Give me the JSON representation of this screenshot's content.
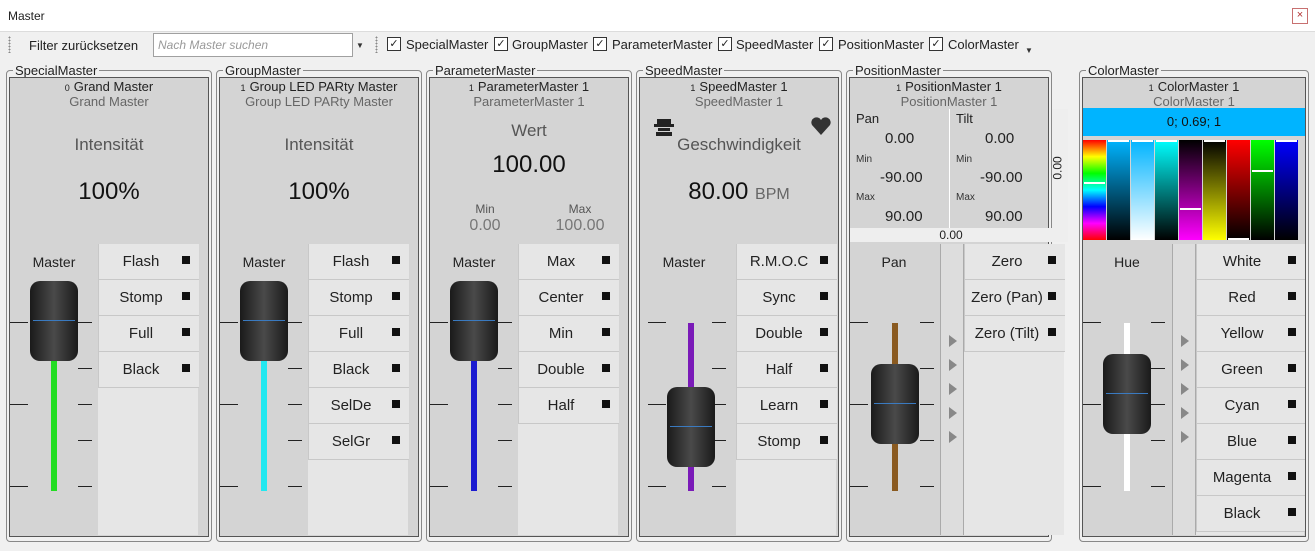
{
  "window": {
    "title": "Master",
    "close_symbol": "×"
  },
  "toolbar": {
    "filter_reset": "Filter zurücksetzen",
    "search_placeholder": "Nach Master suchen",
    "filters": [
      {
        "label": "SpecialMaster",
        "checked": true
      },
      {
        "label": "GroupMaster",
        "checked": true
      },
      {
        "label": "ParameterMaster",
        "checked": true
      },
      {
        "label": "SpeedMaster",
        "checked": true
      },
      {
        "label": "PositionMaster",
        "checked": true
      },
      {
        "label": "ColorMaster",
        "checked": true
      }
    ]
  },
  "panels": {
    "special": {
      "legend": "SpecialMaster",
      "index": "0",
      "name": "Grand Master",
      "subname": "Grand Master",
      "function": "Intensität",
      "value": "100%",
      "fader_label": "Master",
      "fader_color": "#22dd22",
      "buttons": [
        "Flash",
        "Stomp",
        "Full",
        "Black"
      ]
    },
    "group": {
      "legend": "GroupMaster",
      "index": "1",
      "name": "Group LED PARty  Master",
      "subname": "Group LED PARty  Master",
      "function": "Intensität",
      "value": "100%",
      "fader_label": "Master",
      "fader_color": "#22e8f0",
      "buttons": [
        "Flash",
        "Stomp",
        "Full",
        "Black",
        "SelDe",
        "SelGr"
      ]
    },
    "parameter": {
      "legend": "ParameterMaster",
      "index": "1",
      "name": "ParameterMaster 1",
      "subname": "ParameterMaster 1",
      "function": "Wert",
      "value": "100.00",
      "min_label": "Min",
      "min_value": "0.00",
      "max_label": "Max",
      "max_value": "100.00",
      "fader_label": "Master",
      "fader_color": "#1a1ad0",
      "buttons": [
        "Max",
        "Center",
        "Min",
        "Double",
        "Half"
      ]
    },
    "speed": {
      "legend": "SpeedMaster",
      "index": "1",
      "name": "SpeedMaster 1",
      "subname": "SpeedMaster 1",
      "function": "Geschwindigkeit",
      "value": "80.00",
      "unit": "BPM",
      "fader_label": "Master",
      "fader_color": "#7a1ab8",
      "buttons": [
        "R.M.O.C",
        "Sync",
        "Double",
        "Half",
        "Learn",
        "Stomp"
      ]
    },
    "position": {
      "legend": "PositionMaster",
      "index": "1",
      "name": "PositionMaster 1",
      "subname": "PositionMaster 1",
      "pan_label": "Pan",
      "pan_value": "0.00",
      "pan_min": "-90.00",
      "pan_max": "90.00",
      "tilt_label": "Tilt",
      "tilt_value": "0.00",
      "tilt_min": "-90.00",
      "tilt_max": "90.00",
      "min_label": "Min",
      "max_label": "Max",
      "side_value": "0.00",
      "bottom_value": "0.00",
      "fader_label": "Pan",
      "fader_color": "#8a5a20",
      "buttons": [
        "Zero",
        "Zero (Pan)",
        "Zero (Tilt)"
      ]
    },
    "color": {
      "legend": "ColorMaster",
      "index": "1",
      "name": "ColorMaster 1",
      "subname": "ColorMaster 1",
      "color_value": "0; 0.69; 1",
      "fader_label": "Hue",
      "fader_color": "#ffffff",
      "buttons": [
        "White",
        "Red",
        "Yellow",
        "Green",
        "Cyan",
        "Blue",
        "Magenta",
        "Black"
      ]
    }
  },
  "colors": {
    "accent_bar": "#00b4ff"
  }
}
